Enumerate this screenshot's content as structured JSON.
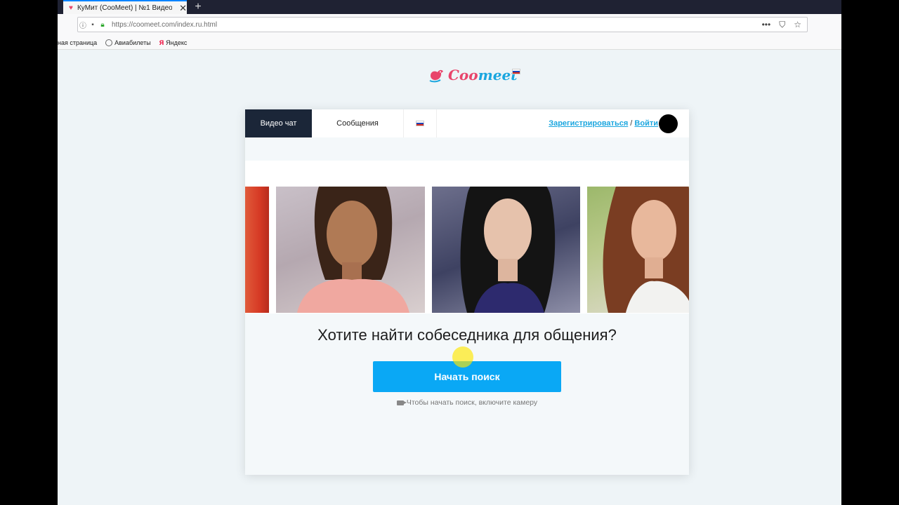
{
  "browser": {
    "tab_title": "КуМит (CooMeet) | №1 Видео",
    "new_tab_symbol": "+",
    "url": "https://coomeet.com/index.ru.html",
    "bookmarks": [
      "ная страница",
      "Авиабилеты",
      "Яндекс"
    ]
  },
  "site": {
    "logo_coo": "Coo",
    "logo_meet": "meet",
    "nav": {
      "video_chat": "Видео чат",
      "messages": "Сообщения",
      "register": "Зарегистрироваться",
      "separator": " / ",
      "login": "Войти"
    },
    "question": "Хотите найти собеседника для общения?",
    "start_button": "Начать поиск",
    "camera_hint": "Чтобы начать поиск, включите камеру"
  },
  "colors": {
    "accent_blue": "#0aa8f5",
    "brand_pink": "#e8456b",
    "nav_dark": "#1b2638"
  }
}
